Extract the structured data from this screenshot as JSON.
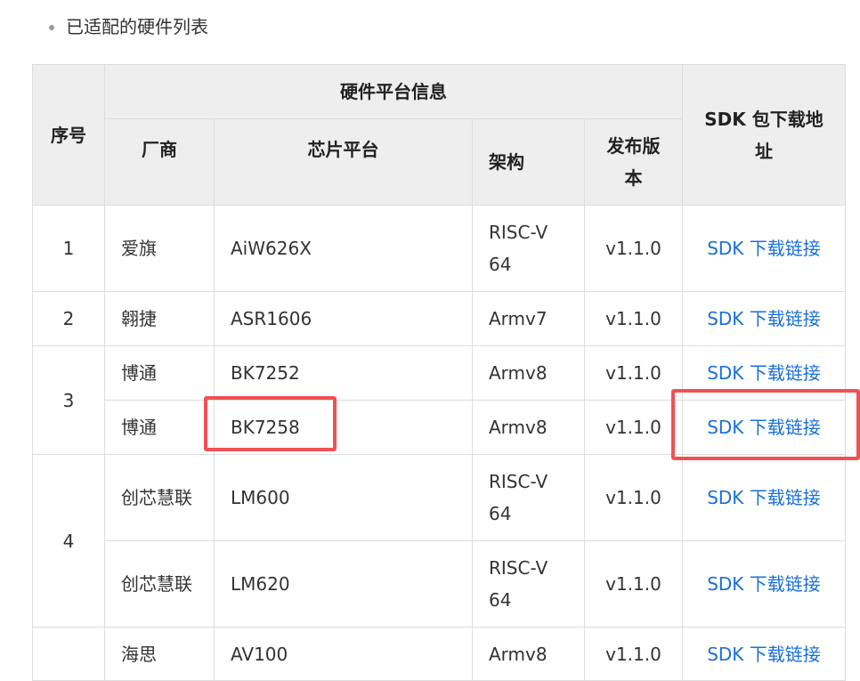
{
  "heading": {
    "text": "已适配的硬件列表"
  },
  "table": {
    "headers": {
      "index": "序号",
      "group": "硬件平台信息",
      "vendor": "厂商",
      "chip": "芯片平台",
      "arch": "架构",
      "version": "发布版本",
      "sdk": "SDK 包下载地址"
    },
    "groups": [
      {
        "index": "1",
        "rows": [
          {
            "vendor": "爱旗",
            "chip": "AiW626X",
            "arch": "RISC-V 64",
            "version": "v1.1.0",
            "sdk": "SDK 下载链接"
          }
        ]
      },
      {
        "index": "2",
        "rows": [
          {
            "vendor": "翱捷",
            "chip": "ASR1606",
            "arch": "Armv7",
            "version": "v1.1.0",
            "sdk": "SDK 下载链接"
          }
        ]
      },
      {
        "index": "3",
        "rows": [
          {
            "vendor": "博通",
            "chip": "BK7252",
            "arch": "Armv8",
            "version": "v1.1.0",
            "sdk": "SDK 下载链接"
          },
          {
            "vendor": "博通",
            "chip": "BK7258",
            "arch": "Armv8",
            "version": "v1.1.0",
            "sdk": "SDK 下载链接"
          }
        ]
      },
      {
        "index": "4",
        "rows": [
          {
            "vendor": "创芯慧联",
            "chip": "LM600",
            "arch": "RISC-V 64",
            "version": "v1.1.0",
            "sdk": "SDK 下载链接"
          },
          {
            "vendor": "创芯慧联",
            "chip": "LM620",
            "arch": "RISC-V 64",
            "version": "v1.1.0",
            "sdk": "SDK 下载链接"
          }
        ]
      },
      {
        "index": "",
        "rows": [
          {
            "vendor": "海思",
            "chip": "AV100",
            "arch": "Armv8",
            "version": "v1.1.0",
            "sdk": "SDK 下载链接"
          }
        ]
      }
    ]
  },
  "colors": {
    "highlight": "#ee5253",
    "link": "#1a6fd8",
    "header_bg": "#eeeeee",
    "border": "#dddddd"
  }
}
